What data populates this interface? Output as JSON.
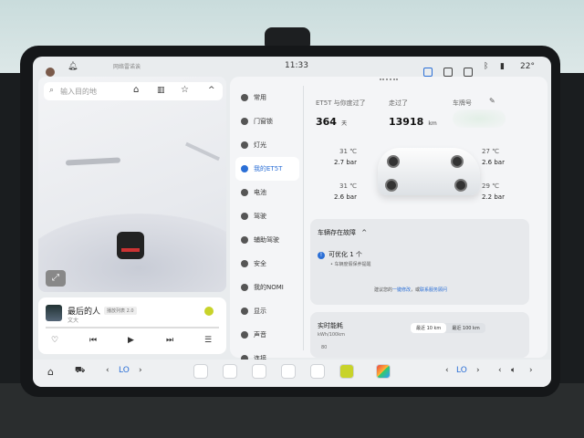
{
  "status_bar": {
    "time": "11:33",
    "network_text": "网络雷诺诶",
    "temperature": "22°"
  },
  "map": {
    "search_placeholder": "输入目的地",
    "collapse_glyph": "^",
    "fullscreen_glyph": "⤢"
  },
  "music": {
    "song_title": "最后的人",
    "song_tag": "播放列表 2.0",
    "artist": "文大",
    "prev_glyph": "⏮",
    "play_glyph": "▶",
    "next_glyph": "⏭",
    "like_glyph": "♡",
    "list_glyph": "☰"
  },
  "sidebar": {
    "items": [
      {
        "label": "常用"
      },
      {
        "label": "门窗锁"
      },
      {
        "label": "灯光"
      },
      {
        "label": "我的ET5T"
      },
      {
        "label": "电池"
      },
      {
        "label": "驾驶"
      },
      {
        "label": "辅助驾驶"
      },
      {
        "label": "安全"
      },
      {
        "label": "我的NOMI"
      },
      {
        "label": "显示"
      },
      {
        "label": "声音"
      },
      {
        "label": "连接"
      }
    ],
    "active_index": 3
  },
  "vehicle": {
    "days_label": "ET5T 与你度过了",
    "days_value": "364",
    "days_unit": "天",
    "distance_label": "走过了",
    "distance_value": "13918",
    "distance_unit": "km",
    "plate_label": "车牌号",
    "tires": {
      "front_left": {
        "temp": "31 ℃",
        "pressure": "2.7 bar"
      },
      "front_right": {
        "temp": "27 ℃",
        "pressure": "2.6 bar"
      },
      "rear_left": {
        "temp": "31 ℃",
        "pressure": "2.6 bar"
      },
      "rear_right": {
        "temp": "29 ℃",
        "pressure": "2.2 bar"
      }
    }
  },
  "fault_card": {
    "title": "车辆存在故障",
    "item_text": "可优化 1 个",
    "sub_text": "• 车辆度假保养提醒",
    "advice_prefix": "建议您的",
    "advice_link_1": "一键修改",
    "advice_mid": "，或",
    "advice_link_2": "联系服务顾问"
  },
  "energy_card": {
    "title": "实时能耗",
    "unit": "kWh/100km",
    "tab_1": "最近 10 km",
    "tab_2": "最近 100 km",
    "y_tick": "80"
  },
  "dock": {
    "left_temp": "LO",
    "right_temp": "LO",
    "left_arrow": "‹",
    "right_arrow": "›"
  },
  "colors": {
    "accent": "#2b6fd6",
    "bezel": "#151719"
  }
}
